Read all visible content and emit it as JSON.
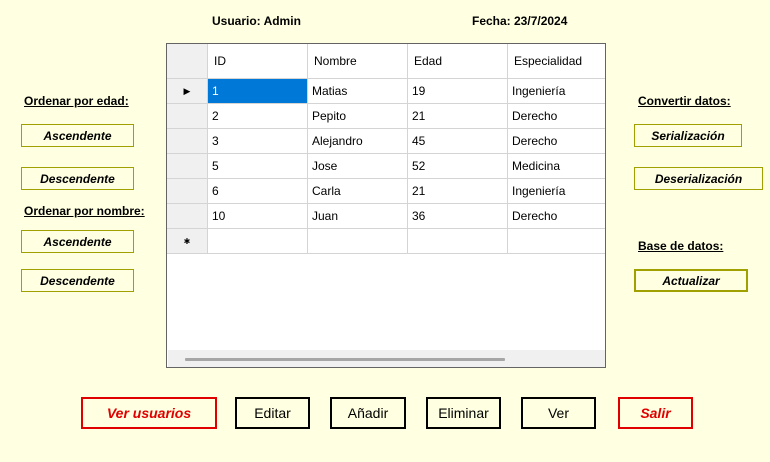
{
  "header": {
    "usuario": "Usuario: Admin",
    "fecha": "Fecha: 23/7/2024"
  },
  "left": {
    "ordenar_edad": "Ordenar por edad:",
    "asc1": "Ascendente",
    "desc1": "Descendente",
    "ordenar_nombre": "Ordenar por nombre:",
    "asc2": "Ascendente",
    "desc2": "Descendente"
  },
  "right": {
    "convertir": "Convertir datos:",
    "serializacion": "Serialización",
    "deserializacion": "Deserialización",
    "base_datos": "Base de datos:",
    "actualizar": "Actualizar"
  },
  "grid": {
    "columns": [
      "ID",
      "Nombre",
      "Edad",
      "Especialidad"
    ],
    "rows": [
      [
        "1",
        "Matias",
        "19",
        "Ingeniería"
      ],
      [
        "2",
        "Pepito",
        "21",
        "Derecho"
      ],
      [
        "3",
        "Alejandro",
        "45",
        "Derecho"
      ],
      [
        "5",
        "Jose",
        "52",
        "Medicina"
      ],
      [
        "6",
        "Carla",
        "21",
        "Ingeniería"
      ],
      [
        "10",
        "Juan",
        "36",
        "Derecho"
      ]
    ],
    "current_row_marker": "▶",
    "new_row_marker": "✱"
  },
  "bottom": {
    "ver_usuarios": "Ver usuarios",
    "editar": "Editar",
    "anadir": "Añadir",
    "eliminar": "Eliminar",
    "ver": "Ver",
    "salir": "Salir"
  },
  "colors": {
    "background": "#ffffe1",
    "accent_red": "#e00000",
    "border_olive": "#a0a000",
    "selection": "#0078d7"
  }
}
